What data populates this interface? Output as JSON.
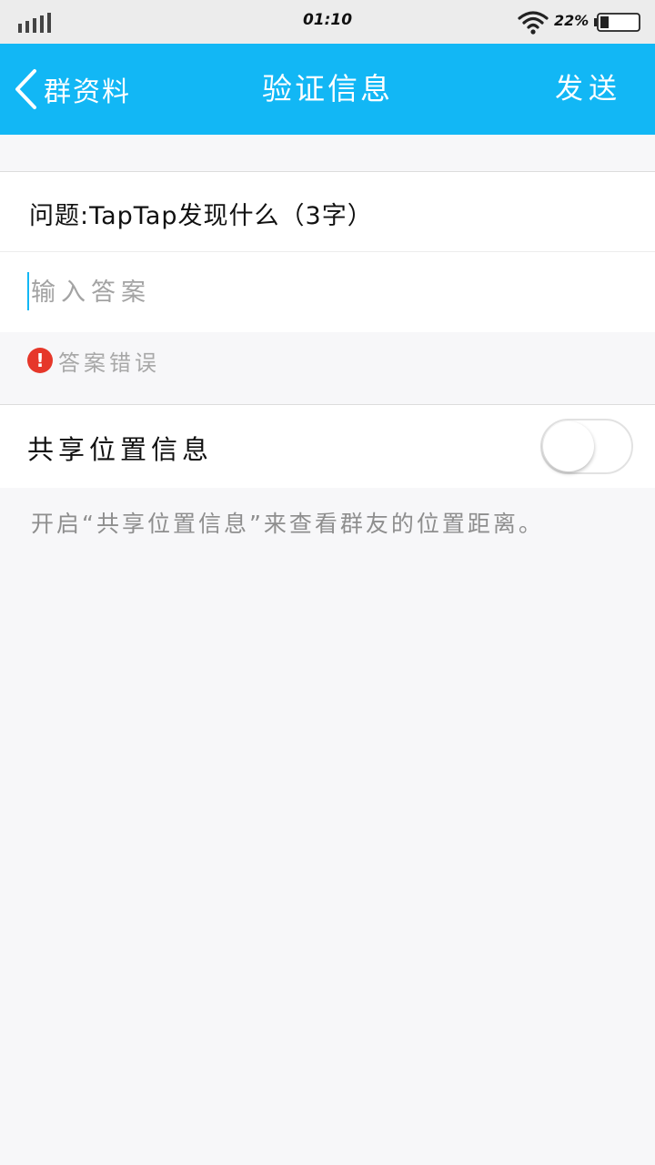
{
  "status_bar": {
    "time": "01:10",
    "battery_percent": "22%",
    "battery_level": 0.22,
    "signal_icon": "signal-bars-icon",
    "wifi_icon": "wifi-icon",
    "battery_icon": "battery-icon"
  },
  "nav": {
    "back_icon": "chevron-left-icon",
    "back_label": "群资料",
    "title": "验证信息",
    "send_label": "发送",
    "background_color": "#12b7f5"
  },
  "form": {
    "question": "问题:TapTap发现什么（3字）",
    "answer_value": "",
    "answer_placeholder": "输入答案",
    "error_icon": "exclamation-icon",
    "error_text": "答案错误",
    "error_color": "#e6372a"
  },
  "share_location": {
    "label": "共享位置信息",
    "enabled": false,
    "hint": "开启“共享位置信息”来查看群友的位置距离。"
  }
}
